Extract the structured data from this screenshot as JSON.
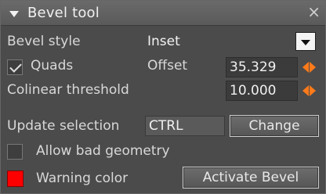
{
  "panel": {
    "title": "Bevel tool",
    "close_glyph": "×"
  },
  "bevel_style": {
    "label": "Bevel style",
    "value": "Inset"
  },
  "quads": {
    "label": "Quads",
    "checked": true
  },
  "offset": {
    "label": "Offset",
    "value": "35.329"
  },
  "colinear": {
    "label": "Colinear threshold",
    "value": "10.000"
  },
  "update_selection": {
    "label": "Update selection",
    "key": "CTRL",
    "button_label": "Change"
  },
  "allow_bad_geometry": {
    "label": "Allow bad geometry",
    "checked": false
  },
  "warning_color": {
    "label": "Warning color",
    "color": "#ff0000"
  },
  "activate_button": {
    "label": "Activate Bevel"
  },
  "colors": {
    "accent_spinner": "#ff7a1a",
    "panel_bg": "#4b4b4b"
  }
}
